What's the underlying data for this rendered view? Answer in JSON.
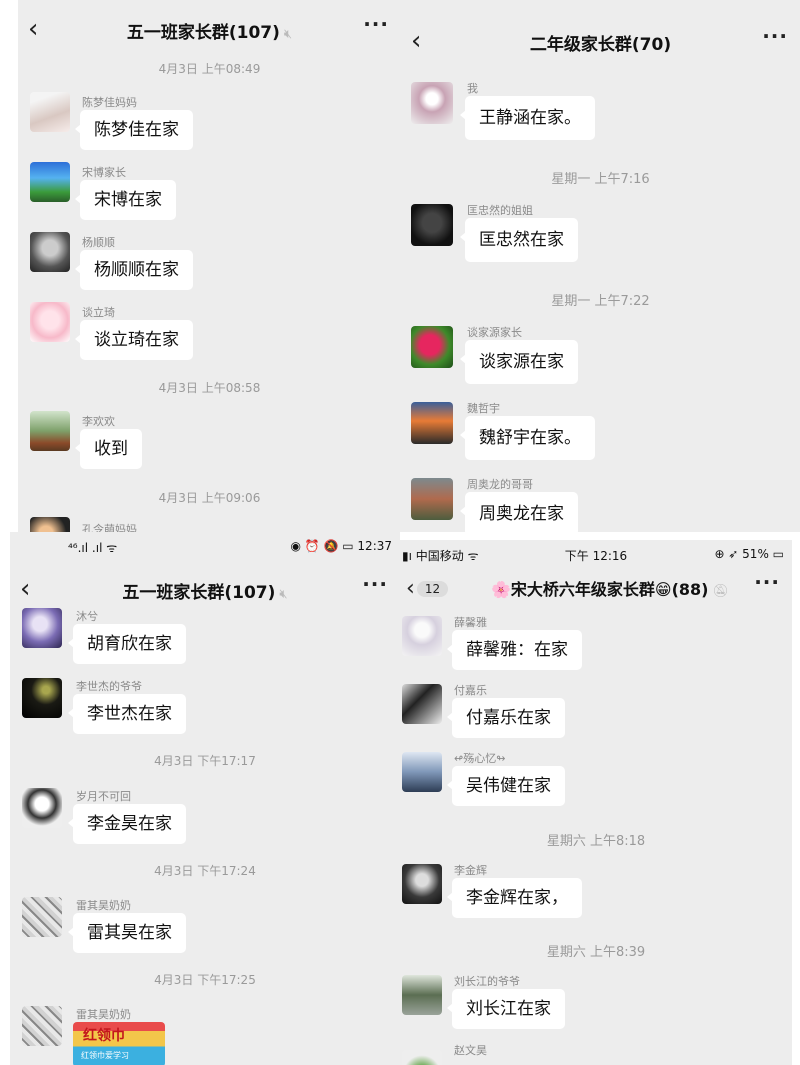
{
  "panels": [
    {
      "title": "五一班家长群(107)",
      "messages_top_timestamp": "4月3日 上午08:49",
      "items": [
        {
          "sender": "陈梦佳妈妈",
          "text": "陈梦佳在家",
          "avatar": "anime-girl-avatar"
        },
        {
          "sender": "宋博家长",
          "text": "宋博在家",
          "avatar": "landscape-avatar"
        },
        {
          "sender": "杨顺顺",
          "text": "杨顺顺在家",
          "avatar": "person-avatar"
        },
        {
          "sender": "谈立琦",
          "text": "谈立琦在家",
          "avatar": "pink-anime-avatar"
        }
      ],
      "timestamp2": "4月3日 上午08:58",
      "items2": [
        {
          "sender": "李欢欢",
          "text": "收到",
          "avatar": "plant-avatar"
        }
      ],
      "timestamp3": "4月3日 上午09:06",
      "partial_sender": "孔令萌妈妈"
    },
    {
      "title": "二年级家长群(70)",
      "first": {
        "sender": "我",
        "text": "王静涵在家。"
      },
      "timestamp1": "星期一 上午7:16",
      "second": {
        "sender": "匡忠然的姐姐",
        "text": "匡忠然在家"
      },
      "timestamp2": "星期一 上午7:22",
      "items": [
        {
          "sender": "谈家源家长",
          "text": "谈家源在家"
        },
        {
          "sender": "魏哲宇",
          "text": "魏舒宇在家。"
        },
        {
          "sender": "周奥龙的哥哥",
          "text": "周奥龙在家"
        }
      ]
    },
    {
      "status_left": "⁴⁶.ıl .ıl ᯤ",
      "status_right": "◉ ⏰ 🔕 ▭ 12:37",
      "title": "五一班家长群(107)",
      "items": [
        {
          "sender": "沐兮",
          "text": "胡育欣在家"
        },
        {
          "sender": "李世杰的爷爷",
          "text": "李世杰在家"
        }
      ],
      "timestamp1": "4月3日 下午17:17",
      "item3": {
        "sender": "岁月不可回",
        "text": "李金昊在家"
      },
      "timestamp2": "4月3日 下午17:24",
      "item4": {
        "sender": "雷其昊奶奶",
        "text": "雷其昊在家"
      },
      "timestamp3": "4月3日 下午17:25",
      "item5": {
        "sender": "雷其昊奶奶",
        "image_title": "红领巾",
        "image_sub": "红领巾爱学习"
      }
    },
    {
      "status_left": "▮ı 中国移动 ᯤ",
      "status_center": "下午 12:16",
      "status_right": "⊕ ➶ 51% ▭",
      "back_count": "12",
      "title": "🌸宋大桥六年级家长群😁(88)",
      "items": [
        {
          "sender": "薛馨雅",
          "text": "薛馨雅：在家"
        },
        {
          "sender": "付嘉乐",
          "text": "付嘉乐在家"
        },
        {
          "sender": "↫殇心忆↬",
          "text": "吴伟健在家"
        }
      ],
      "timestamp1": "星期六 上午8:18",
      "item4": {
        "sender": "李金辉",
        "text": "李金辉在家，"
      },
      "timestamp2": "星期六 上午8:39",
      "item5": {
        "sender": "刘长江的爷爷",
        "text": "刘长江在家"
      },
      "item6": {
        "sender": "赵文昊"
      }
    }
  ],
  "icons": {
    "back": "chevron-left-icon",
    "more": "more-dots-icon",
    "mute": "mute-icon"
  }
}
